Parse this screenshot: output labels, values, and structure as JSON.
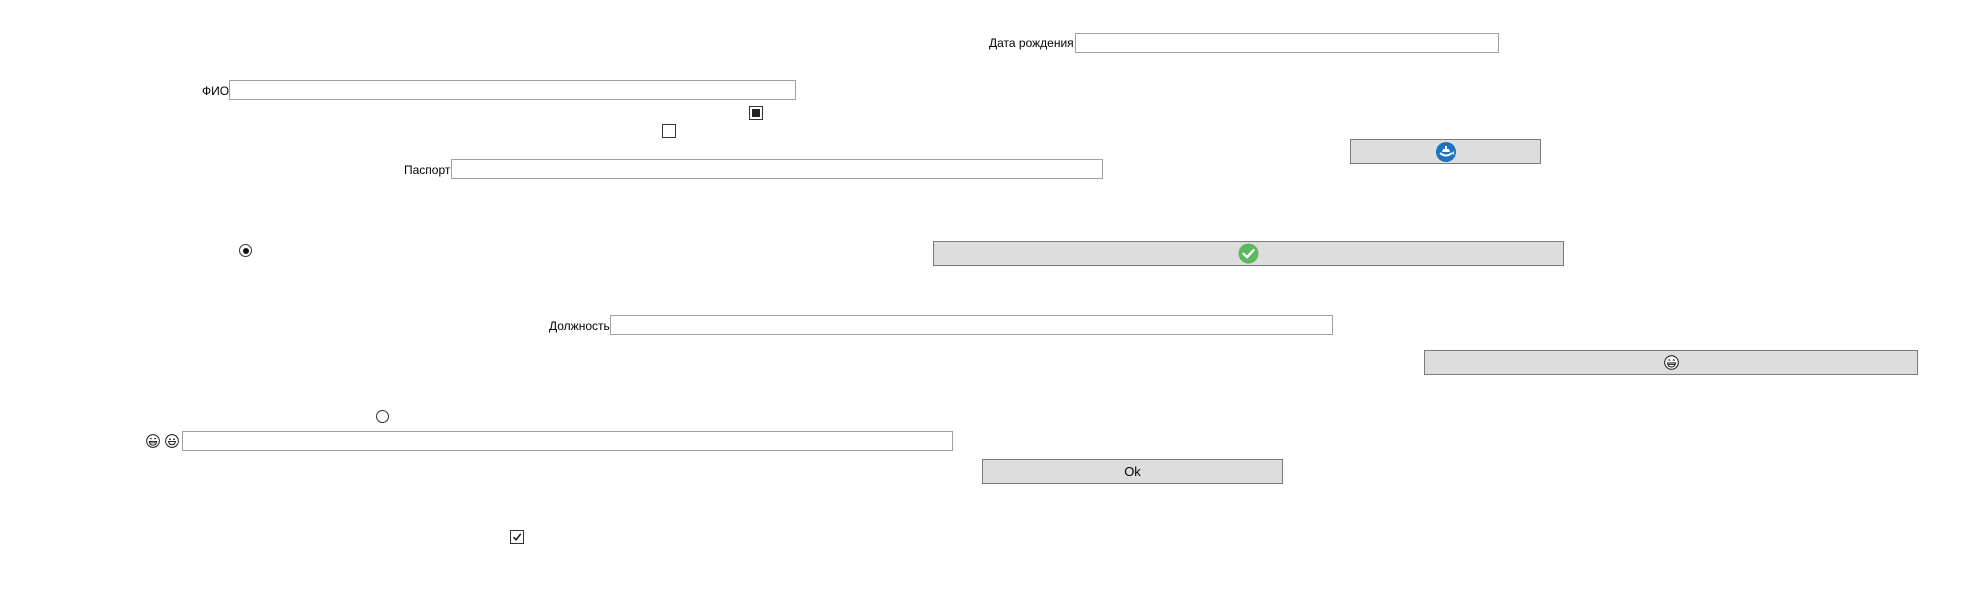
{
  "form": {
    "birth_date": {
      "label": "Дата рождения",
      "value": ""
    },
    "full_name": {
      "label": "ФИО",
      "value": ""
    },
    "passport": {
      "label": "Паспорт",
      "value": ""
    },
    "position": {
      "label": "Должность",
      "value": ""
    },
    "emoji_field": {
      "value": ""
    }
  },
  "checkboxes": [
    {
      "state": "indeterminate"
    },
    {
      "state": "unchecked"
    },
    {
      "state": "checked"
    }
  ],
  "radios": [
    {
      "selected": true
    },
    {
      "selected": false
    }
  ],
  "buttons": {
    "refresh_icon_button": {
      "icon": "ship-refresh-icon",
      "color": "#1e73be"
    },
    "confirm_icon_button": {
      "icon": "check-circle-icon",
      "color": "#5cb85c"
    },
    "emoji_button": {
      "icon": "grin-emoji-icon"
    },
    "ok_button": {
      "label": "Ok"
    }
  },
  "emoji_label": {
    "icons": [
      "grin-emoji-icon",
      "grinning-emoji-icon"
    ]
  }
}
